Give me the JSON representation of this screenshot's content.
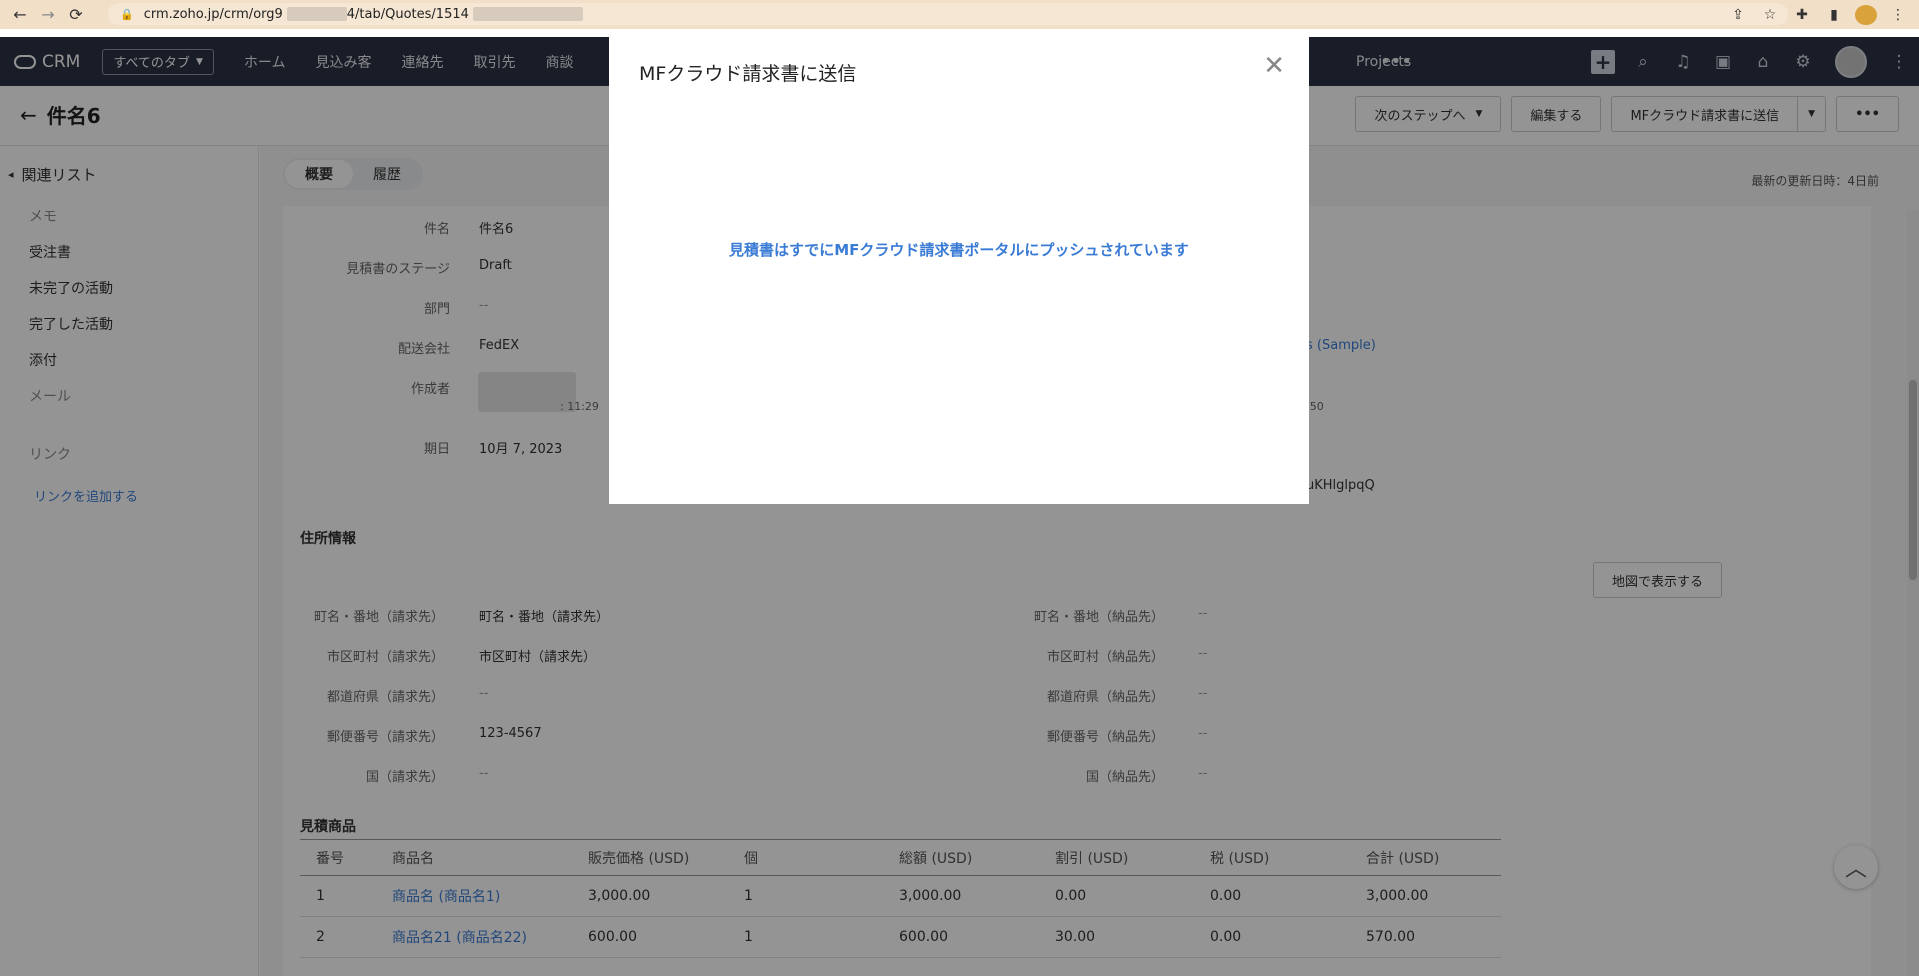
{
  "browser": {
    "url": "crm.zoho.jp/crm/org9",
    "url_tail": "4/tab/Quotes/1514"
  },
  "nav": {
    "logo": "CRM",
    "tabs_dropdown": "すべてのタブ",
    "links": [
      "ホーム",
      "見込み客",
      "連絡先",
      "取引先",
      "商談"
    ],
    "projects": "Projects"
  },
  "record": {
    "title": "件名6",
    "next_step": "次のステップへ",
    "edit": "編集する",
    "send_mf": "MFクラウド請求書に送信"
  },
  "sidebar": {
    "related_list": "関連リスト",
    "items": [
      "メモ",
      "受注書",
      "未完了の活動",
      "完了した活動",
      "添付",
      "メール"
    ],
    "links_heading": "リンク",
    "add_link": "リンクを追加する"
  },
  "content": {
    "tab_overview": "概要",
    "tab_history": "履歴",
    "last_updated": "最新の更新日時：4日前"
  },
  "fields": {
    "subject_label": "件名",
    "subject_value": "件名6",
    "stage_label": "見積書のステージ",
    "stage_value": "Draft",
    "dept_label": "部門",
    "dept_value": "--",
    "carrier_label": "配送会社",
    "carrier_value": "FedEX",
    "creator_label": "作成者",
    "creator_time": ": 11:29",
    "due_label": "期日",
    "due_value": "10月 7, 2023",
    "right_link": "s (Sample)",
    "right_time": ":50",
    "right_code": "uKHlglpqQ"
  },
  "address": {
    "title": "住所情報",
    "map_button": "地図で表示する",
    "billing": [
      {
        "label": "町名・番地（請求先）",
        "value": "町名・番地（請求先）"
      },
      {
        "label": "市区町村（請求先）",
        "value": "市区町村（請求先）"
      },
      {
        "label": "都道府県（請求先）",
        "value": "--"
      },
      {
        "label": "郵便番号（請求先）",
        "value": "123-4567"
      },
      {
        "label": "国（請求先）",
        "value": "--"
      }
    ],
    "shipping": [
      {
        "label": "町名・番地（納品先）",
        "value": "--"
      },
      {
        "label": "市区町村（納品先）",
        "value": "--"
      },
      {
        "label": "都道府県（納品先）",
        "value": "--"
      },
      {
        "label": "郵便番号（納品先）",
        "value": "--"
      },
      {
        "label": "国（納品先）",
        "value": "--"
      }
    ]
  },
  "products": {
    "title": "見積商品",
    "headers": [
      "番号",
      "商品名",
      "販売価格 (USD)",
      "個",
      "総額 (USD)",
      "割引 (USD)",
      "税 (USD)",
      "合計 (USD)"
    ],
    "rows": [
      [
        "1",
        "商品名 (商品名1)",
        "3,000.00",
        "1",
        "3,000.00",
        "0.00",
        "0.00",
        "3,000.00"
      ],
      [
        "2",
        "商品名21 (商品名22)",
        "600.00",
        "1",
        "600.00",
        "30.00",
        "0.00",
        "570.00"
      ]
    ]
  },
  "modal": {
    "title": "MFクラウド請求書に送信",
    "message": "見積書はすでにMFクラウド請求書ポータルにプッシュされています"
  }
}
